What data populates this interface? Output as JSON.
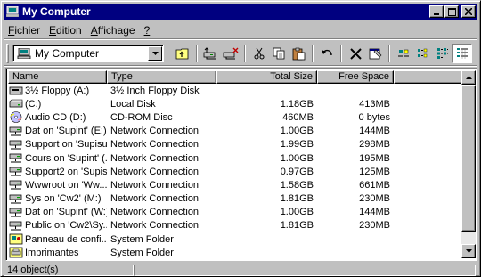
{
  "window": {
    "title": "My Computer"
  },
  "menu": [
    {
      "pre": "",
      "u": "F",
      "post": "ichier"
    },
    {
      "pre": "",
      "u": "E",
      "post": "dition"
    },
    {
      "pre": "",
      "u": "A",
      "post": "ffichage"
    },
    {
      "pre": "",
      "u": "?",
      "post": ""
    }
  ],
  "address": {
    "value": "My Computer"
  },
  "columns": {
    "name": "Name",
    "type": "Type",
    "total": "Total Size",
    "free": "Free Space"
  },
  "rows": [
    {
      "icon": "floppy-icon",
      "name": "3½ Floppy (A:)",
      "type": "3½ Inch Floppy Disk",
      "total": "",
      "free": ""
    },
    {
      "icon": "hard-disk-icon",
      "name": "(C:)",
      "type": "Local Disk",
      "total": "1.18GB",
      "free": "413MB"
    },
    {
      "icon": "cd-rom-icon",
      "name": "Audio CD (D:)",
      "type": "CD-ROM Disc",
      "total": "460MB",
      "free": "0 bytes"
    },
    {
      "icon": "network-drive-icon",
      "name": "Dat on 'Supint' (E:)",
      "type": "Network Connection",
      "total": "1.00GB",
      "free": "144MB"
    },
    {
      "icon": "network-drive-icon",
      "name": "Support on 'Supisu...",
      "type": "Network Connection",
      "total": "1.99GB",
      "free": "298MB"
    },
    {
      "icon": "network-drive-icon",
      "name": "Cours on 'Supint' (...",
      "type": "Network Connection",
      "total": "1.00GB",
      "free": "195MB"
    },
    {
      "icon": "network-drive-icon",
      "name": "Support2 on 'Supis...",
      "type": "Network Connection",
      "total": "0.97GB",
      "free": "125MB"
    },
    {
      "icon": "network-drive-icon",
      "name": "Wwwroot on 'Ww...",
      "type": "Network Connection",
      "total": "1.58GB",
      "free": "661MB"
    },
    {
      "icon": "network-drive-icon",
      "name": "Sys on 'Cw2' (M:)",
      "type": "Network Connection",
      "total": "1.81GB",
      "free": "230MB"
    },
    {
      "icon": "network-drive-icon",
      "name": "Dat on 'Supint' (W:)",
      "type": "Network Connection",
      "total": "1.00GB",
      "free": "144MB"
    },
    {
      "icon": "network-drive-icon",
      "name": "Public on 'Cw2\\Sy...",
      "type": "Network Connection",
      "total": "1.81GB",
      "free": "230MB"
    },
    {
      "icon": "control-panel-icon",
      "name": "Panneau de confi...",
      "type": "System Folder",
      "total": "",
      "free": ""
    },
    {
      "icon": "printers-icon",
      "name": "Imprimantes",
      "type": "System Folder",
      "total": "",
      "free": ""
    }
  ],
  "status": {
    "count": "14 object(s)"
  },
  "colors": {
    "titlebar": "#000080",
    "face": "#c0c0c0"
  }
}
